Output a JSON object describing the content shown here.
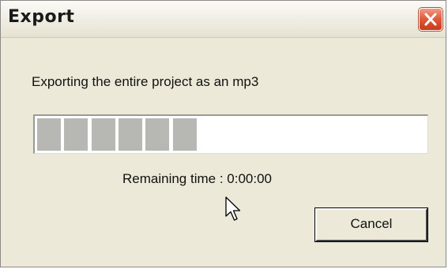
{
  "window": {
    "title": "Export"
  },
  "dialog": {
    "message": "Exporting the entire project as an mp3",
    "remaining_time": "Remaining time : 0:00:00",
    "cancel_label": "Cancel"
  },
  "progress": {
    "fraction": 0.42,
    "filled_blocks": 6,
    "block_color": "#b7b7b3"
  },
  "colors": {
    "dialog_background": "#ECE9D8",
    "close_button": "#e0583a"
  },
  "icons": {
    "close": "close-icon",
    "cursor": "mouse-pointer-icon"
  }
}
